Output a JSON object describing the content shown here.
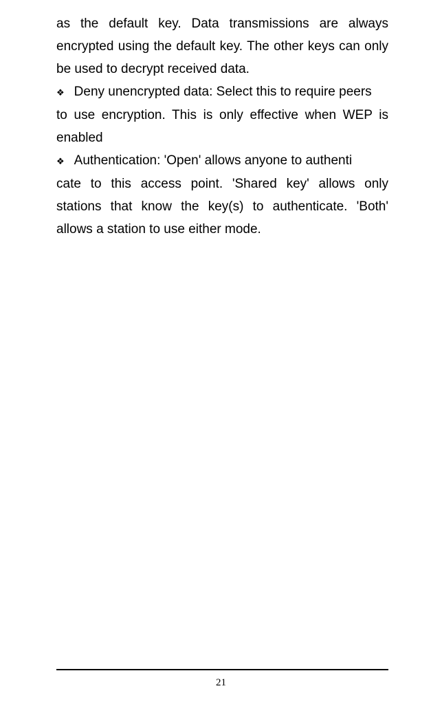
{
  "body": {
    "lead_in": "as the default key. Data transmissions are always encrypted using the default key. The other keys can only be used to decrypt received data.",
    "bullets": [
      {
        "glyph": "❖",
        "first_line": "Deny unencrypted data: Select this to require peers",
        "continuation": "to use encryption. This is only effective when WEP is enabled"
      },
      {
        "glyph": "❖",
        "first_line": "Authentication: 'Open' allows anyone to authenti",
        "continuation": "cate to this access point. 'Shared key' allows only stations that know the key(s) to authenticate. 'Both' allows a station to use either mode."
      }
    ]
  },
  "footer": {
    "page_number": "21"
  }
}
